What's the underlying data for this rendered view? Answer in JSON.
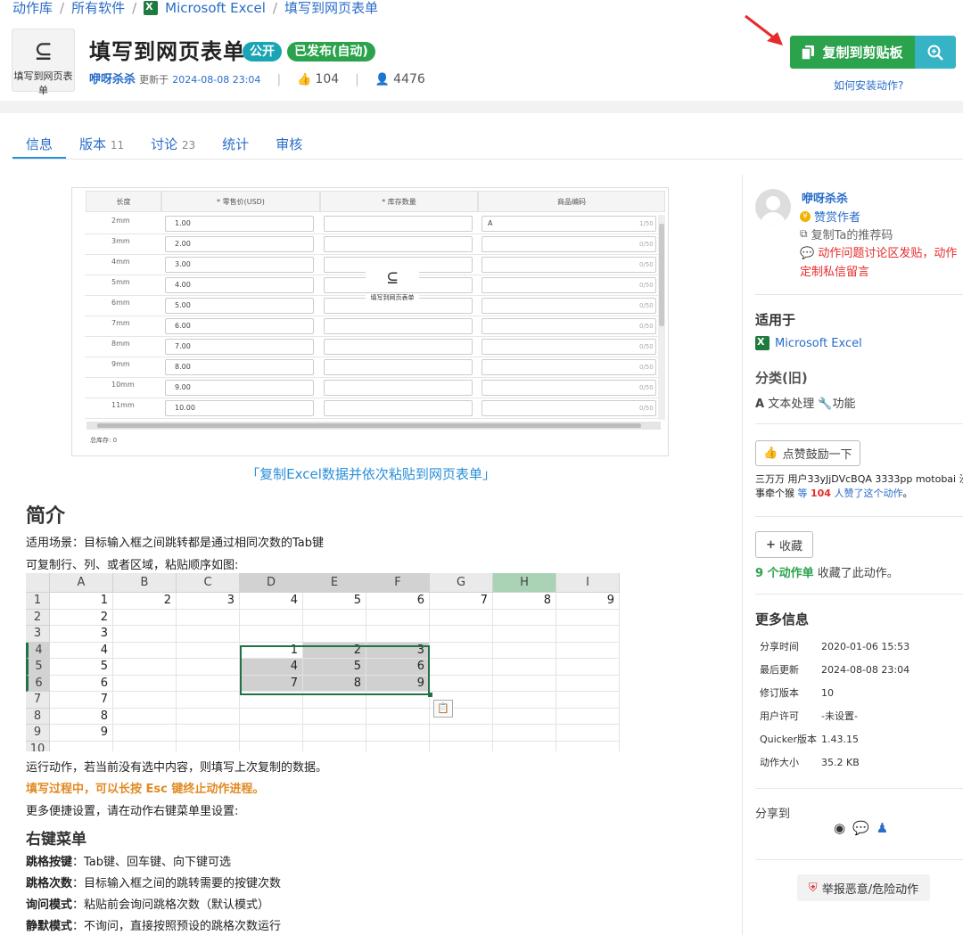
{
  "breadcrumb": {
    "items": [
      "动作库",
      "所有软件",
      "Microsoft Excel",
      "填写到网页表单"
    ],
    "sep": "/"
  },
  "action": {
    "logo_caption": "填写到网页表单",
    "title": "填写到网页表单",
    "badge_public": "公开",
    "badge_published": "已发布(自动)",
    "author": "咿呀杀杀",
    "updated_label": "更新于",
    "updated_at": "2024-08-08 23:04",
    "likes": "104",
    "users": "4476"
  },
  "header_actions": {
    "copy_label": "复制到剪贴板",
    "install_link": "如何安装动作?"
  },
  "tabs": [
    {
      "label": "信息",
      "count": ""
    },
    {
      "label": "版本",
      "count": "11"
    },
    {
      "label": "讨论",
      "count": "23"
    },
    {
      "label": "统计",
      "count": ""
    },
    {
      "label": "审核",
      "count": ""
    }
  ],
  "screenshot1": {
    "headers": [
      "长度",
      "* 零售价(USD)",
      "* 库存数量",
      "商品编码"
    ],
    "rows": [
      {
        "label": "2mm",
        "price": "1.00",
        "code": "A",
        "count": "1/50"
      },
      {
        "label": "3mm",
        "price": "2.00",
        "code": "",
        "count": "0/50"
      },
      {
        "label": "4mm",
        "price": "3.00",
        "code": "",
        "count": "0/50"
      },
      {
        "label": "5mm",
        "price": "4.00",
        "code": "",
        "count": "0/50"
      },
      {
        "label": "6mm",
        "price": "5.00",
        "code": "",
        "count": "0/50"
      },
      {
        "label": "7mm",
        "price": "6.00",
        "code": "",
        "count": "0/50"
      },
      {
        "label": "8mm",
        "price": "7.00",
        "code": "",
        "count": "0/50"
      },
      {
        "label": "9mm",
        "price": "8.00",
        "code": "",
        "count": "0/50"
      },
      {
        "label": "10mm",
        "price": "9.00",
        "code": "",
        "count": "0/50"
      },
      {
        "label": "11mm",
        "price": "10.00",
        "code": "",
        "count": "0/50"
      }
    ],
    "footer": "总库存: 0",
    "overlay_caption": "填写到网页表单"
  },
  "caption": "「复制Excel数据并依次粘贴到网页表单」",
  "intro": {
    "heading": "简介",
    "line1": "适用场景：目标输入框之间跳转都是通过相同次数的Tab键",
    "line2": "可复制行、列、或者区域，粘贴顺序如图:",
    "line3": "运行动作，若当前没有选中内容，则填写上次复制的数据。",
    "line4": "填写过程中，可以长按 Esc 键终止动作进程。",
    "line5": "更多便捷设置，请在动作右键菜单里设置:"
  },
  "excel": {
    "columns": [
      "A",
      "B",
      "C",
      "D",
      "E",
      "F",
      "G",
      "H",
      "I"
    ],
    "row_labels": [
      "1",
      "2",
      "3",
      "4",
      "5",
      "6",
      "7",
      "8",
      "9",
      "10"
    ],
    "row1": [
      "1",
      "2",
      "3",
      "4",
      "5",
      "6",
      "7",
      "8",
      "9"
    ],
    "col_a": [
      "1",
      "2",
      "3",
      "4",
      "5",
      "6",
      "7",
      "8",
      "9"
    ],
    "block": [
      [
        "1",
        "2",
        "3"
      ],
      [
        "4",
        "5",
        "6"
      ],
      [
        "7",
        "8",
        "9"
      ]
    ]
  },
  "menu": {
    "heading": "右键菜单",
    "items": [
      {
        "key": "跳格按键",
        "value": "：Tab键、回车键、向下键可选"
      },
      {
        "key": "跳格次数",
        "value": "：目标输入框之间的跳转需要的按键次数"
      },
      {
        "key": "询问模式",
        "value": "：粘贴前会询问跳格次数（默认模式）"
      },
      {
        "key": "静默模式",
        "value": "：不询问，直接按照预设的跳格次数运行"
      }
    ]
  },
  "sidebar": {
    "author": "咿呀杀杀",
    "praise": "赞赏作者",
    "copy_ref": "复制Ta的推荐码",
    "warn1": "动作问题讨论区发贴，动作",
    "warn2": "定制私信留言",
    "applies_heading": "适用于",
    "applies_app": "Microsoft Excel",
    "category_heading": "分类(旧)",
    "category_text": "文本处理",
    "category_text2": "功能",
    "like_label": "点赞鼓励一下",
    "likers_line1": "三万万 用户33yJjDVcBQA 3333pp motobai 沙",
    "likers_pre": "事牵个猴",
    "likers_link1": "等",
    "likers_count": "104",
    "likers_link2": "人赞了这个动作",
    "likers_end": "。",
    "fav_label": "收藏",
    "fav_count": "9 个动作单",
    "fav_text": "收藏了此动作。",
    "more_heading": "更多信息",
    "more": [
      {
        "k": "分享时间",
        "v": "2020-01-06 15:53"
      },
      {
        "k": "最后更新",
        "v": "2024-08-08 23:04"
      },
      {
        "k": "修订版本",
        "v": "10"
      },
      {
        "k": "用户许可",
        "v": "-未设置-"
      },
      {
        "k": "Quicker版本",
        "v": "1.43.15"
      },
      {
        "k": "动作大小",
        "v": "35.2 KB"
      }
    ],
    "share_label": "分享到",
    "report_label": "举报恶意/危险动作"
  },
  "colors": {
    "green": "#2ba24c",
    "teal": "#1aa5b5",
    "link": "#2a6cc8",
    "red": "#e62b2b",
    "orange": "#e08a23"
  }
}
